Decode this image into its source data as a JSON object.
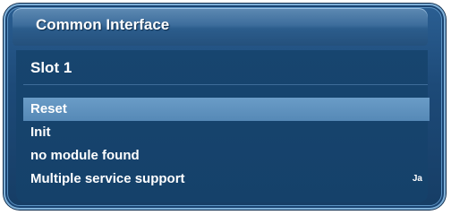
{
  "dialog": {
    "title": "Common Interface",
    "slot_label": "Slot 1"
  },
  "menu": {
    "items": [
      {
        "label": "Reset",
        "value": "",
        "selected": true
      },
      {
        "label": "Init",
        "value": "",
        "selected": false
      },
      {
        "label": "no module found",
        "value": "",
        "selected": false
      },
      {
        "label": "Multiple service support",
        "value": "Ja",
        "selected": false
      }
    ]
  },
  "colors": {
    "frame": "#1d4a78",
    "title_bar": "#3d6d9c",
    "selected_row": "#5f92bf",
    "text": "#ffffff"
  }
}
